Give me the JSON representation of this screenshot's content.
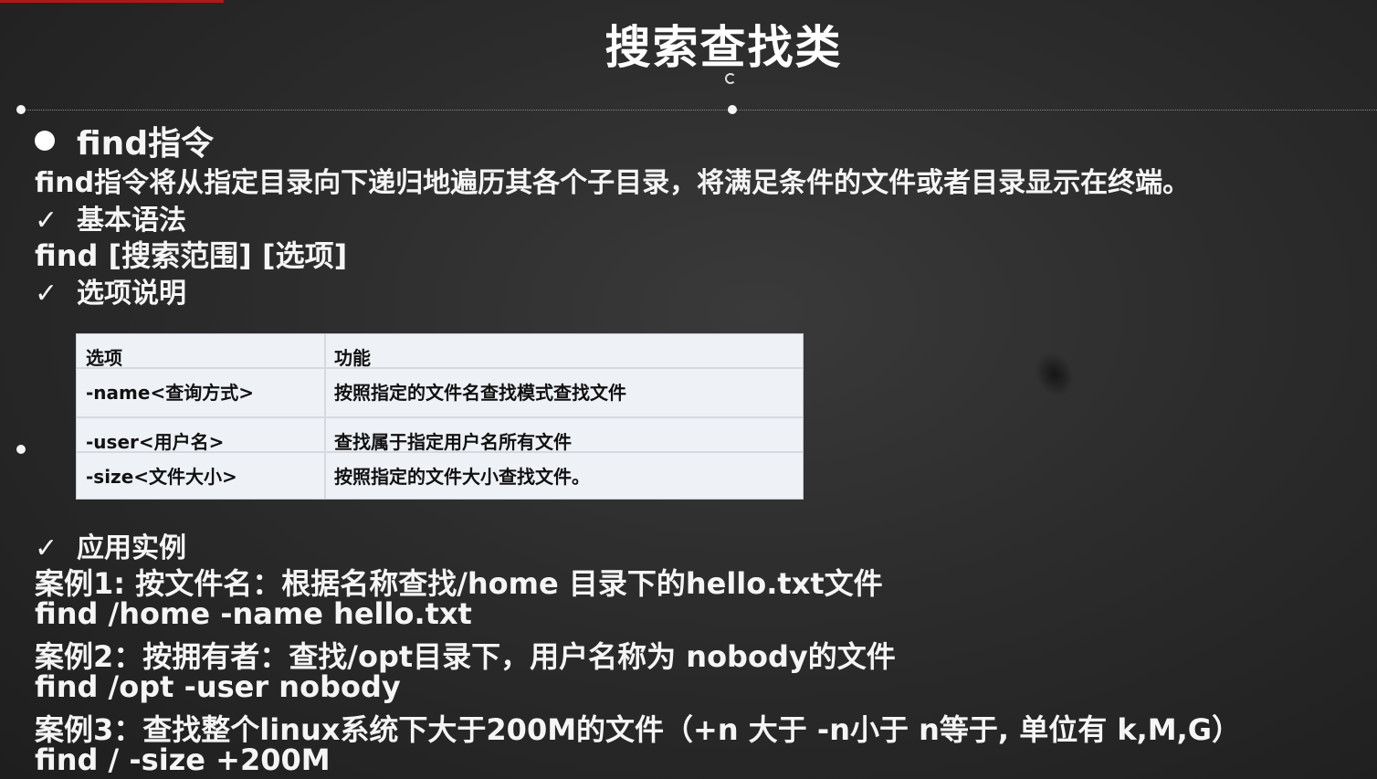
{
  "slide": {
    "title": "搜索查找类",
    "heading": "find指令",
    "description": "find指令将从指定目录向下递归地遍历其各个子目录，将满足条件的文件或者目录显示在终端。",
    "check_mark": "✓",
    "basic_syntax_label": "基本语法",
    "syntax": "find  [搜索范围]  [选项]",
    "options_label": "选项说明",
    "table": {
      "headers": [
        "选项",
        "功能"
      ],
      "rows": [
        [
          "-name<查询方式>",
          "按照指定的文件名查找模式查找文件"
        ],
        [
          "-user<用户名>",
          "查找属于指定用户名所有文件"
        ],
        [
          "-size<文件大小>",
          "按照指定的文件大小查找文件。"
        ]
      ]
    },
    "examples_label": "应用实例",
    "examples": [
      {
        "case": "案例1: 按文件名：根据名称查找/home 目录下的hello.txt文件",
        "command": "find /home -name hello.txt"
      },
      {
        "case": "案例2：按拥有者：查找/opt目录下，用户名称为 nobody的文件",
        "command": "find /opt -user nobody"
      },
      {
        "case": "案例3：查找整个linux系统下大于200M的文件（+n 大于  -n小于   n等于, 单位有 k,M,G）",
        "command": "find / -size +200M"
      }
    ]
  },
  "colors": {
    "background": "#2c2c2c",
    "text": "#f5f5f5",
    "table_bg": "#eef1f6",
    "accent": "#b01818"
  }
}
